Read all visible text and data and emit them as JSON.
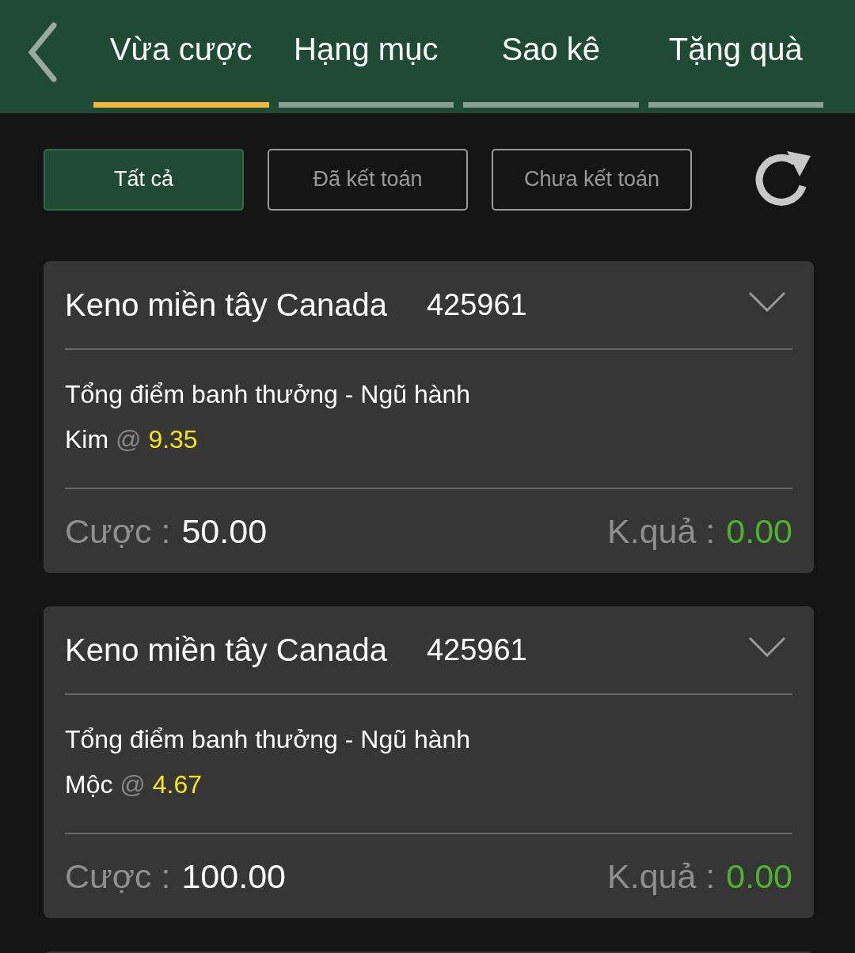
{
  "tabs": [
    {
      "label": "Vừa cược",
      "selected": true
    },
    {
      "label": "Hạng mục",
      "selected": false
    },
    {
      "label": "Sao kê",
      "selected": false
    },
    {
      "label": "Tặng quà",
      "selected": false
    }
  ],
  "filters": [
    {
      "label": "Tất cả",
      "selected": true
    },
    {
      "label": "Đã kết toán",
      "selected": false
    },
    {
      "label": "Chưa kết toán",
      "selected": false
    }
  ],
  "bets": [
    {
      "game": "Keno miền tây Canada",
      "draw": "425961",
      "market": "Tổng điểm banh thưởng - Ngũ hành",
      "selection": "Kim",
      "at": "@",
      "odds": "9.35",
      "stake_label": "Cược :",
      "stake": "50.00",
      "result_label": "K.quả :",
      "result": "0.00"
    },
    {
      "game": "Keno miền tây Canada",
      "draw": "425961",
      "market": "Tổng điểm banh thưởng - Ngũ hành",
      "selection": "Mộc",
      "at": "@",
      "odds": "4.67",
      "stake_label": "Cược :",
      "stake": "100.00",
      "result_label": "K.quả :",
      "result": "0.00"
    }
  ]
}
